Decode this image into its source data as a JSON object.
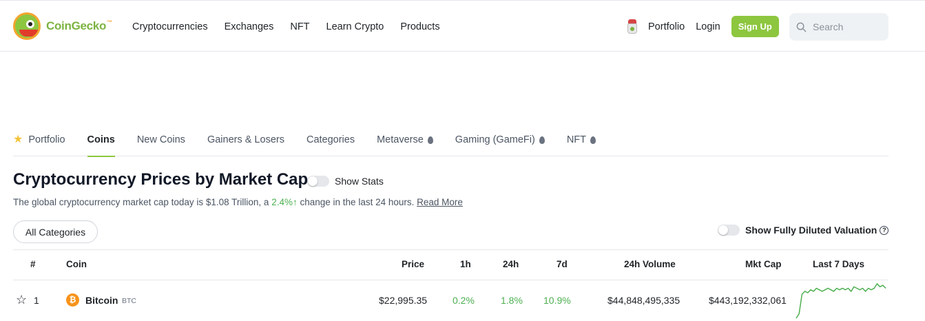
{
  "brand": {
    "name": "CoinGecko",
    "tm": "™"
  },
  "main_nav": [
    "Cryptocurrencies",
    "Exchanges",
    "NFT",
    "Learn Crypto",
    "Products"
  ],
  "right_nav": {
    "portfolio": "Portfolio",
    "login": "Login",
    "signup": "Sign Up",
    "search_placeholder": "Search"
  },
  "tabs": [
    {
      "label": "Portfolio",
      "icon": "star-icon"
    },
    {
      "label": "Coins",
      "active": true
    },
    {
      "label": "New Coins"
    },
    {
      "label": "Gainers & Losers"
    },
    {
      "label": "Categories"
    },
    {
      "label": "Metaverse",
      "icon": "drop-icon"
    },
    {
      "label": "Gaming (GameFi)",
      "icon": "drop-icon"
    },
    {
      "label": "NFT",
      "icon": "drop-icon"
    }
  ],
  "page": {
    "title": "Cryptocurrency Prices by Market Cap",
    "show_stats": "Show Stats",
    "subtitle_pre": "The global cryptocurrency market cap today is $1.08 Trillion, a",
    "subtitle_change": "2.4%↑",
    "subtitle_post": "change in the last 24 hours.",
    "read_more": "Read More",
    "categories_button": "All Categories",
    "fdv_label": "Show Fully Diluted Valuation",
    "help_icon": "?"
  },
  "table": {
    "headers": [
      "#",
      "Coin",
      "Price",
      "1h",
      "24h",
      "7d",
      "24h Volume",
      "Mkt Cap",
      "Last 7 Days"
    ],
    "rows": [
      {
        "rank": "1",
        "name": "Bitcoin",
        "symbol": "BTC",
        "icon_glyph": "₿",
        "price": "$22,995.35",
        "h1": "0.2%",
        "h24": "1.8%",
        "d7": "10.9%",
        "volume": "$44,848,495,335",
        "mkt_cap": "$443,192,332,061",
        "sparkline": [
          2,
          5,
          18,
          20,
          19,
          21,
          20,
          22,
          21,
          20,
          21,
          22,
          21,
          20,
          22,
          21,
          22,
          21,
          22,
          20,
          23,
          22,
          21,
          22,
          20,
          22,
          21,
          22,
          25,
          23,
          24,
          22
        ],
        "sparkline_color": "#4caf50"
      }
    ]
  },
  "colors": {
    "accent": "#8dc63f",
    "up": "#4caf50"
  }
}
